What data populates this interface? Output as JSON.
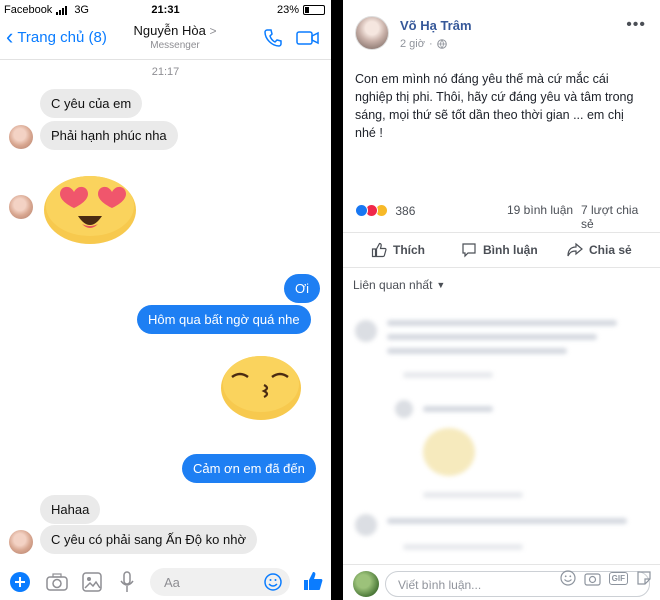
{
  "messenger": {
    "status_bar": {
      "carrier": "Facebook",
      "network": "3G",
      "time": "21:31",
      "battery": "23%"
    },
    "header": {
      "back_label": "Trang chủ (8)",
      "contact_name": "Nguyễn Hòa",
      "subtitle": "Messenger",
      "name_chevron": ">"
    },
    "timestamp": "21:17",
    "messages": [
      {
        "from": "them",
        "text": "C yêu của em"
      },
      {
        "from": "them",
        "text": "Phải hạnh phúc nha"
      },
      {
        "from": "me",
        "text": "Ơi"
      },
      {
        "from": "me",
        "text": "Hôm qua bất ngờ quá nhe"
      },
      {
        "from": "me",
        "text": "Cảm ơn em đã đến"
      },
      {
        "from": "them",
        "text": "Hahaa"
      },
      {
        "from": "them",
        "text": "C yêu có phải sang Ấn Độ ko nhờ"
      }
    ],
    "composer": {
      "placeholder": "Aa"
    }
  },
  "facebook_post": {
    "author": "Võ Hạ Trâm",
    "time": "2 giờ",
    "text": "Con em mình nó đáng yêu thế mà cứ mắc cái nghiệp thị phi. Thôi, hãy cứ đáng yêu và tâm trong sáng, mọi thứ sẽ tốt dần theo thời gian ... em chị nhé !",
    "reaction_count": "386",
    "comments_count": "19 bình luận",
    "shares_count": "7 lượt chia sẻ",
    "actions": {
      "like": "Thích",
      "comment": "Bình luận",
      "share": "Chia sẻ"
    },
    "sort_label": "Liên quan nhất",
    "comment_placeholder": "Viết bình luận...",
    "gif_label": "GIF"
  },
  "colors": {
    "messenger_blue": "#1e7ff3",
    "incoming_bubble": "#eaeaea",
    "facebook_link": "#365899",
    "divider": "#000000"
  }
}
